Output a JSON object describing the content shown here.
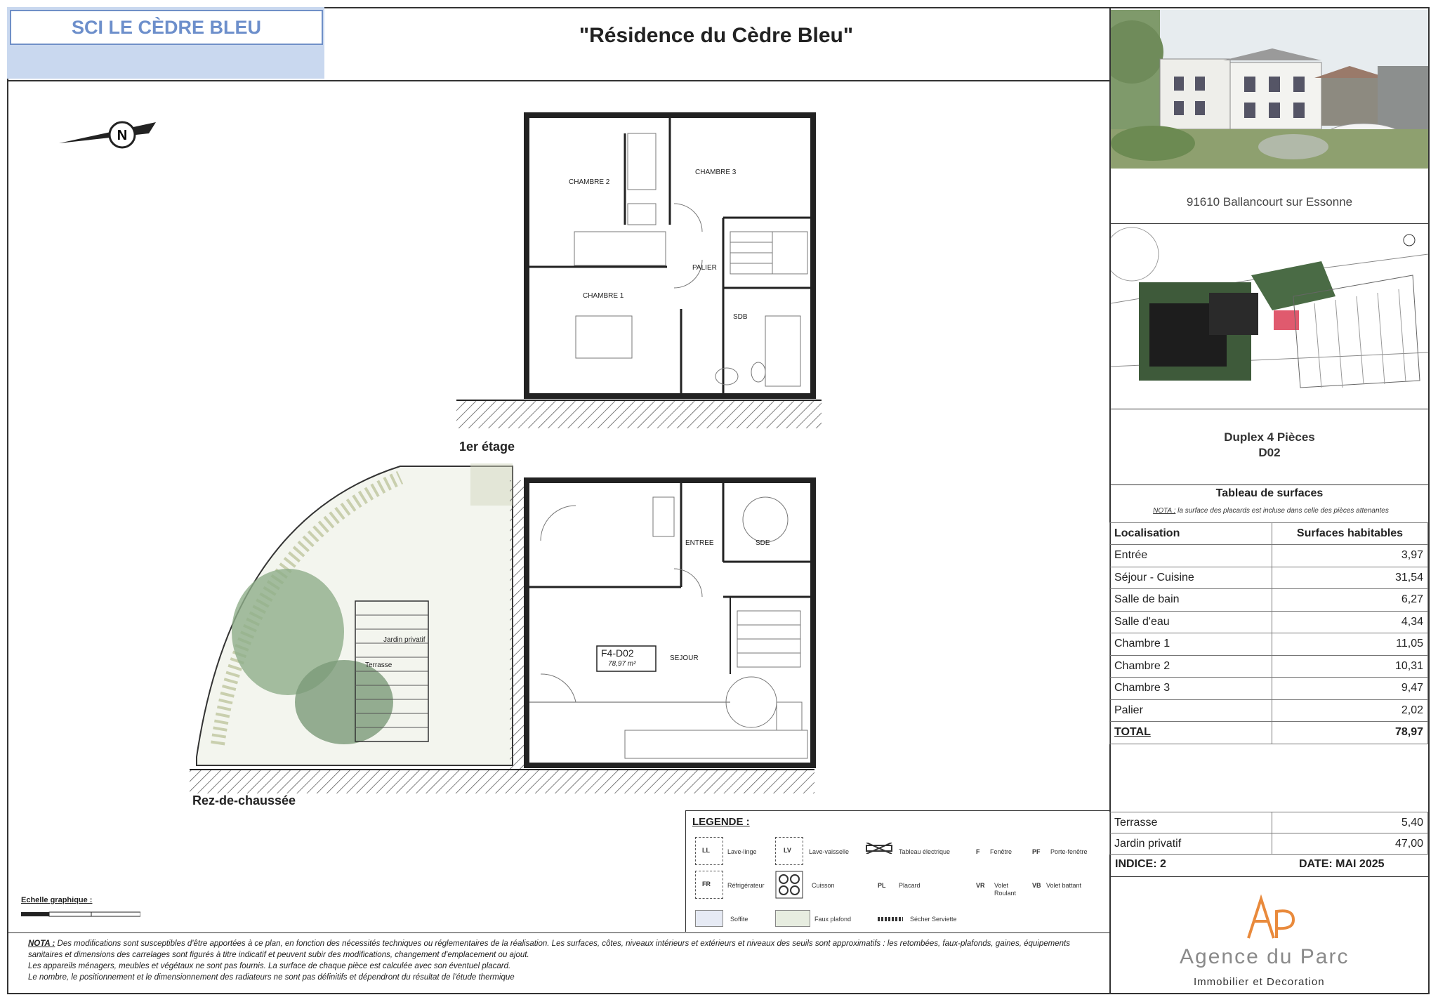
{
  "header": {
    "company": "SCI LE CÈDRE BLEU",
    "title": "\"Résidence du Cèdre Bleu\""
  },
  "project": {
    "address": "91610 Ballancourt sur Essonne",
    "type": "Duplex 4 Pièces",
    "lot": "D02"
  },
  "surfaces": {
    "title": "Tableau de surfaces",
    "note_label": "NOTA :",
    "note_text": "la surface des placards est incluse dans celle des pièces attenantes",
    "col_location": "Localisation",
    "col_surface": "Surfaces habitables",
    "rows": [
      {
        "name": "Entrée",
        "value": "3,97"
      },
      {
        "name": "Séjour - Cuisine",
        "value": "31,54"
      },
      {
        "name": "Salle de bain",
        "value": "6,27"
      },
      {
        "name": "Salle d'eau",
        "value": "4,34"
      },
      {
        "name": "Chambre 1",
        "value": "11,05"
      },
      {
        "name": "Chambre 2",
        "value": "10,31"
      },
      {
        "name": "Chambre 3",
        "value": "9,47"
      },
      {
        "name": "Palier",
        "value": "2,02"
      }
    ],
    "total_label": "TOTAL",
    "total_value": "78,97",
    "terrasse_label": "Terrasse",
    "terrasse_value": "5,40",
    "jardin_label": "Jardin privatif",
    "jardin_value": "47,00",
    "indice": "INDICE: 2",
    "date": "DATE: MAI 2025"
  },
  "plan": {
    "upper_label": "1er étage",
    "ground_label": "Rez-de-chaussée",
    "apt_code": "F4-D02",
    "apt_area": "78,97 m²",
    "rooms_upper": [
      "CHAMBRE 2",
      "CHAMBRE 3",
      "CHAMBRE 1",
      "PALIER",
      "SDB"
    ],
    "rooms_ground": [
      "ENTREE",
      "SDE",
      "SEJOUR",
      "Terrasse",
      "Jardin privatif"
    ],
    "scale_label": "Echelle graphique :"
  },
  "legend": {
    "title": "LEGENDE :",
    "items": {
      "ll": "LL",
      "ll_text": "Lave-linge",
      "lv": "LV",
      "lv_text": "Lave-vaisselle",
      "tab": "Tableau électrique",
      "f": "F",
      "f_text": "Fenêtre",
      "pf": "PF",
      "pf_text": "Porte-fenêtre",
      "fr": "FR",
      "fr_text": "Réfrigérateur",
      "cuisson": "Cuisson",
      "pl": "PL",
      "pl_text": "Placard",
      "vr": "VR",
      "vr_text": "Volet Roulant",
      "vb": "VB",
      "vb_text": "Volet battant",
      "soffite": "Soffite",
      "faux": "Faux plafond",
      "seche": "Sécher Serviette"
    }
  },
  "note": {
    "label": "NOTA :",
    "line1": "Des modifications sont susceptibles d'être apportées à ce plan, en fonction des nécessités techniques ou réglementaires de la réalisation. Les surfaces, côtes, niveaux intérieurs et extérieurs et niveaux des seuils sont approximatifs : les retombées, faux-plafonds, gaines, équipements sanitaires et dimensions des carrelages sont figurés à titre indicatif et peuvent subir des modifications, changement d'emplacement ou ajout.",
    "line2": "Les appareils ménagers, meubles et végétaux ne sont pas fournis. La surface de chaque pièce est calculée avec son éventuel placard.",
    "line3": "Le nombre, le positionnement et le dimensionnement des radiateurs ne sont pas définitifs et dépendront du résultat de l'étude thermique"
  },
  "logo": {
    "name": "Agence du Parc",
    "sub": "Immobilier et Decoration"
  }
}
